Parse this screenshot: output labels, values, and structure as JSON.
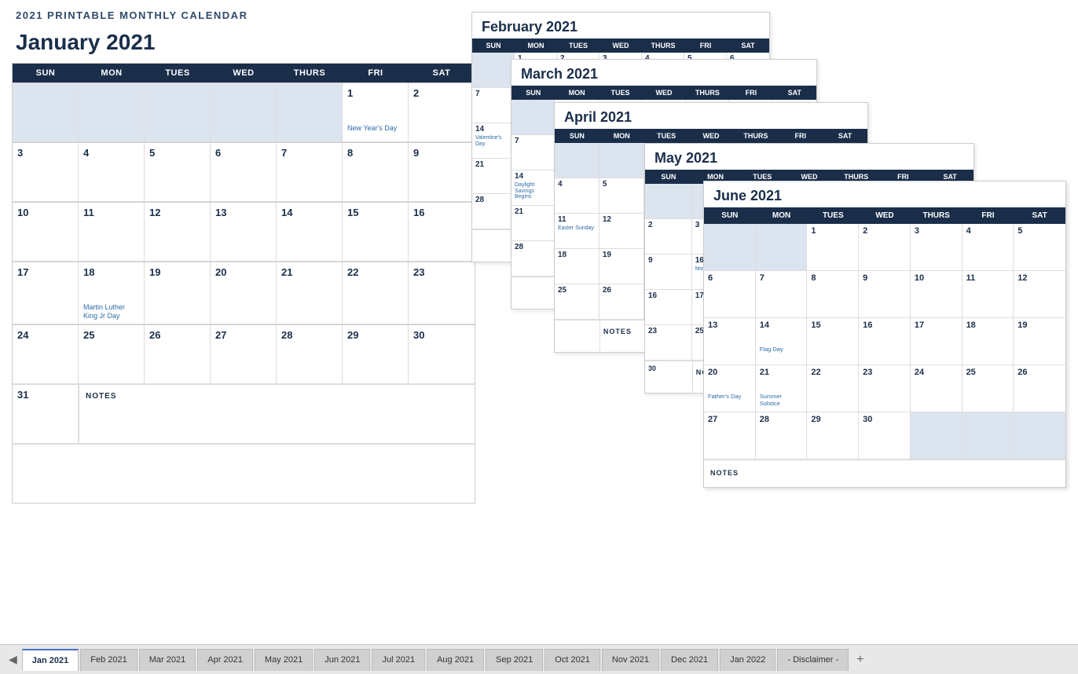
{
  "title": "2021 PRINTABLE MONTHLY CALENDAR",
  "january": {
    "month_title": "January 2021",
    "days": [
      "SUN",
      "MON",
      "TUES",
      "WED",
      "THURS",
      "FRI",
      "SAT"
    ],
    "weeks": [
      [
        {
          "num": "",
          "empty": true
        },
        {
          "num": "",
          "empty": true
        },
        {
          "num": "",
          "empty": true
        },
        {
          "num": "",
          "empty": true
        },
        {
          "num": "",
          "empty": true
        },
        {
          "num": "1",
          "holiday": "New Year's Day"
        },
        {
          "num": "2"
        }
      ],
      [
        {
          "num": "3"
        },
        {
          "num": "4"
        },
        {
          "num": "5"
        },
        {
          "num": "6"
        },
        {
          "num": "7"
        },
        {
          "num": "8"
        },
        {
          "num": "9"
        }
      ],
      [
        {
          "num": "10"
        },
        {
          "num": "11"
        },
        {
          "num": "12"
        },
        {
          "num": "13"
        },
        {
          "num": "14"
        },
        {
          "num": "15"
        },
        {
          "num": "16"
        }
      ],
      [
        {
          "num": "17"
        },
        {
          "num": "18",
          "holiday": "Martin Luther\nKing Jr Day"
        },
        {
          "num": "19"
        },
        {
          "num": "20"
        },
        {
          "num": "21"
        },
        {
          "num": "22"
        },
        {
          "num": "23"
        }
      ],
      [
        {
          "num": "24"
        },
        {
          "num": "25"
        },
        {
          "num": "26"
        },
        {
          "num": "27"
        },
        {
          "num": "28"
        },
        {
          "num": "29"
        },
        {
          "num": "30"
        }
      ]
    ],
    "last_row": [
      {
        "num": "31"
      }
    ],
    "notes_label": "NOTES"
  },
  "february": {
    "title": "February 2021",
    "days": [
      "SUN",
      "MON",
      "TUES",
      "WED",
      "THURS",
      "FRI",
      "SAT"
    ],
    "holiday": "Valentine's Day"
  },
  "march": {
    "title": "March 2021",
    "days": [
      "SUN",
      "MON",
      "TUES",
      "WED",
      "THURS",
      "FRI",
      "SAT"
    ],
    "holiday": "Daylight\nSavings Begins"
  },
  "april": {
    "title": "April 2021",
    "days": [
      "SUN",
      "MON",
      "TUES",
      "WED",
      "THURS",
      "FRI",
      "SAT"
    ],
    "holiday": "Easter Sunday"
  },
  "may": {
    "title": "May 2021",
    "days": [
      "SUN",
      "MON",
      "TUES",
      "WED",
      "THURS",
      "FRI",
      "SAT"
    ],
    "holiday": "Mother's Day"
  },
  "june": {
    "title": "June 2021",
    "days": [
      "SUN",
      "MON",
      "TUES",
      "WED",
      "THURS",
      "FRI",
      "SAT"
    ],
    "weeks": [
      [
        {
          "num": "",
          "empty": true
        },
        {
          "num": "",
          "empty": true
        },
        {
          "num": "1"
        },
        {
          "num": "2"
        },
        {
          "num": "3"
        },
        {
          "num": "4"
        },
        {
          "num": "5"
        }
      ],
      [
        {
          "num": "6"
        },
        {
          "num": "7"
        },
        {
          "num": "8"
        },
        {
          "num": "9"
        },
        {
          "num": "10"
        },
        {
          "num": "11"
        },
        {
          "num": "12"
        }
      ],
      [
        {
          "num": "13"
        },
        {
          "num": "14"
        },
        {
          "num": "15"
        },
        {
          "num": "16"
        },
        {
          "num": "17"
        },
        {
          "num": "18"
        },
        {
          "num": "19"
        }
      ],
      [
        {
          "num": "20"
        },
        {
          "num": "21"
        },
        {
          "num": "22"
        },
        {
          "num": "23"
        },
        {
          "num": "24"
        },
        {
          "num": "25"
        },
        {
          "num": "26"
        }
      ],
      [
        {
          "num": "27"
        },
        {
          "num": "28"
        },
        {
          "num": "29"
        },
        {
          "num": "30"
        },
        {
          "num": "",
          "shaded": true
        },
        {
          "num": "",
          "shaded": true
        },
        {
          "num": "",
          "shaded": true
        }
      ]
    ],
    "holidays": {
      "14": "Flag Day",
      "20": "Father's Day",
      "21": "Summer\nSolstice"
    },
    "notes_label": "NOTES"
  },
  "tabs": [
    "Jan 2021",
    "Feb 2021",
    "Mar 2021",
    "Apr 2021",
    "May 2021",
    "Jun 2021",
    "Jul 2021",
    "Aug 2021",
    "Sep 2021",
    "Oct 2021",
    "Nov 2021",
    "Dec 2021",
    "Jan 2022",
    "- Disclaimer -"
  ],
  "active_tab": "Jan 2021"
}
